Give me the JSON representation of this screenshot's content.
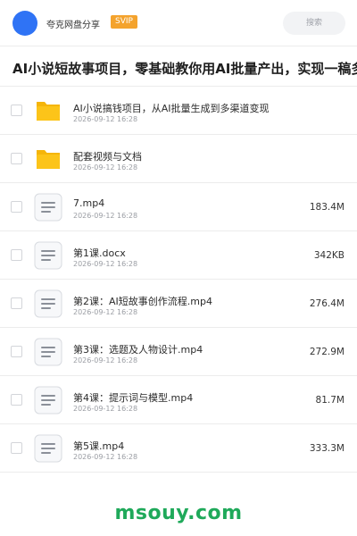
{
  "header": {
    "name": "夸克网盘分享",
    "vip_badge": "SVIP",
    "search_placeholder": "搜索",
    "avatar_color": "#2f73f5"
  },
  "title": "AI小说短故事项目，零基础教你用AI批量产出，实现一稿多",
  "files": [
    {
      "type": "folder",
      "icon": "folder-icon",
      "name": "AI小说搞钱项目，从AI批量生成到多渠道变现",
      "date": "2026-09-12 16:28",
      "size": ""
    },
    {
      "type": "folder",
      "icon": "folder-icon",
      "name": "配套视频与文档",
      "date": "2026-09-12 16:28",
      "size": ""
    },
    {
      "type": "file",
      "icon": "document-icon",
      "name": "7.mp4",
      "date": "2026-09-12 16:28",
      "size": "183.4M"
    },
    {
      "type": "file",
      "icon": "document-icon",
      "name": "第1课.docx",
      "date": "2026-09-12 16:28",
      "size": "342KB"
    },
    {
      "type": "file",
      "icon": "document-icon",
      "name": "第2课：AI短故事创作流程.mp4",
      "date": "2026-09-12 16:28",
      "size": "276.4M"
    },
    {
      "type": "file",
      "icon": "document-icon",
      "name": "第3课：选题及人物设计.mp4",
      "date": "2026-09-12 16:28",
      "size": "272.9M"
    },
    {
      "type": "file",
      "icon": "document-icon",
      "name": "第4课：提示词与模型.mp4",
      "date": "2026-09-12 16:28",
      "size": "81.7M"
    },
    {
      "type": "file",
      "icon": "document-icon",
      "name": "第5课.mp4",
      "date": "2026-09-12 16:28",
      "size": "333.3M"
    }
  ],
  "watermark": "msouy.com",
  "colors": {
    "folder": "#fcc419",
    "folder_tab": "#f5b50a",
    "vip": "#f4a32d",
    "watermark": "#1fa95a"
  }
}
